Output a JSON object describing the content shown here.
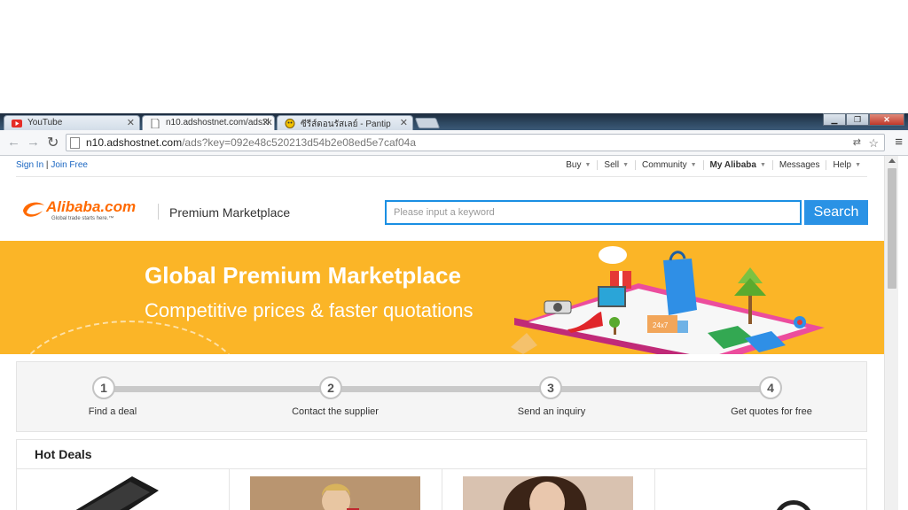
{
  "browser": {
    "tabs": [
      {
        "title": "YouTube",
        "active": false
      },
      {
        "title": "n10.adshostnet.com/ads?k",
        "active": true
      },
      {
        "title": "ซีรีส์ดอนรัสเลย์ - Pantip",
        "active": false
      }
    ],
    "url_host": "n10.adshostnet.com",
    "url_path": "/ads?key=092e48c520213d54b2e08ed5e7caf04a",
    "window_buttons": [
      "minimize",
      "restore",
      "close"
    ]
  },
  "topbar": {
    "sign_in": "Sign In",
    "separator": "|",
    "join_free": "Join Free",
    "nav": [
      {
        "label": "Buy",
        "caret": true,
        "bold": false
      },
      {
        "label": "Sell",
        "caret": true,
        "bold": false
      },
      {
        "label": "Community",
        "caret": true,
        "bold": false
      },
      {
        "label": "My Alibaba",
        "caret": true,
        "bold": true
      },
      {
        "label": "Messages",
        "caret": false,
        "bold": false
      },
      {
        "label": "Help",
        "caret": true,
        "bold": false
      }
    ]
  },
  "header": {
    "logo_text": "Alibaba.com",
    "logo_tagline": "Global trade starts here.™",
    "section_title": "Premium Marketplace",
    "search_placeholder": "Please input a keyword",
    "search_button": "Search"
  },
  "banner": {
    "title": "Global Premium Marketplace",
    "subtitle": "Competitive prices & faster quotations",
    "truck_label": "24x7"
  },
  "steps": [
    {
      "number": "1",
      "label": "Find a deal"
    },
    {
      "number": "2",
      "label": "Contact the supplier"
    },
    {
      "number": "3",
      "label": "Send an inquiry"
    },
    {
      "number": "4",
      "label": "Get quotes for free"
    }
  ],
  "hot_deals": {
    "title": "Hot Deals"
  },
  "colors": {
    "brand_orange": "#ff6a00",
    "banner_yellow": "#fbb527",
    "search_blue": "#2a92e5",
    "link_blue": "#1a66c2"
  }
}
